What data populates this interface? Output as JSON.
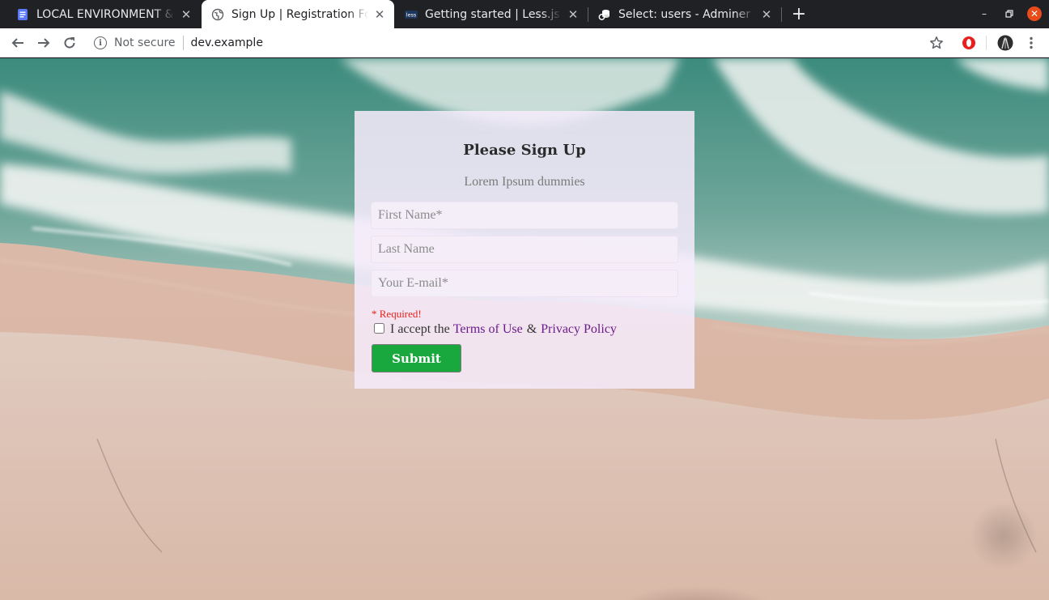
{
  "browser": {
    "tabs": [
      {
        "title": "LOCAL ENVIRONMENT &",
        "favicon": "docs-icon",
        "active": false
      },
      {
        "title": "Sign Up | Registration For",
        "favicon": "globe-icon",
        "active": true
      },
      {
        "title": "Getting started | Less.js",
        "favicon": "less-icon",
        "active": false
      },
      {
        "title": "Select: users - Adminer",
        "favicon": "adminer-icon",
        "active": false
      }
    ],
    "favicon_labels": {
      "less": "less"
    },
    "security_label": "Not secure",
    "url": "dev.example",
    "colors": {
      "tabstrip": "#202124",
      "close_button": "#e94b1b"
    }
  },
  "form": {
    "title": "Please Sign Up",
    "subtitle": "Lorem Ipsum dummies",
    "first_name_placeholder": "First Name*",
    "last_name_placeholder": "Last Name",
    "email_placeholder": "Your E-mail*",
    "required_note": "* Required!",
    "accept_prefix": "I accept the",
    "terms_link": "Terms of Use",
    "ampersand": "&",
    "privacy_link": "Privacy Policy",
    "submit_label": "Submit",
    "colors": {
      "submit": "#19a83e",
      "link": "#6a1b8a",
      "required": "#e8201d"
    }
  }
}
